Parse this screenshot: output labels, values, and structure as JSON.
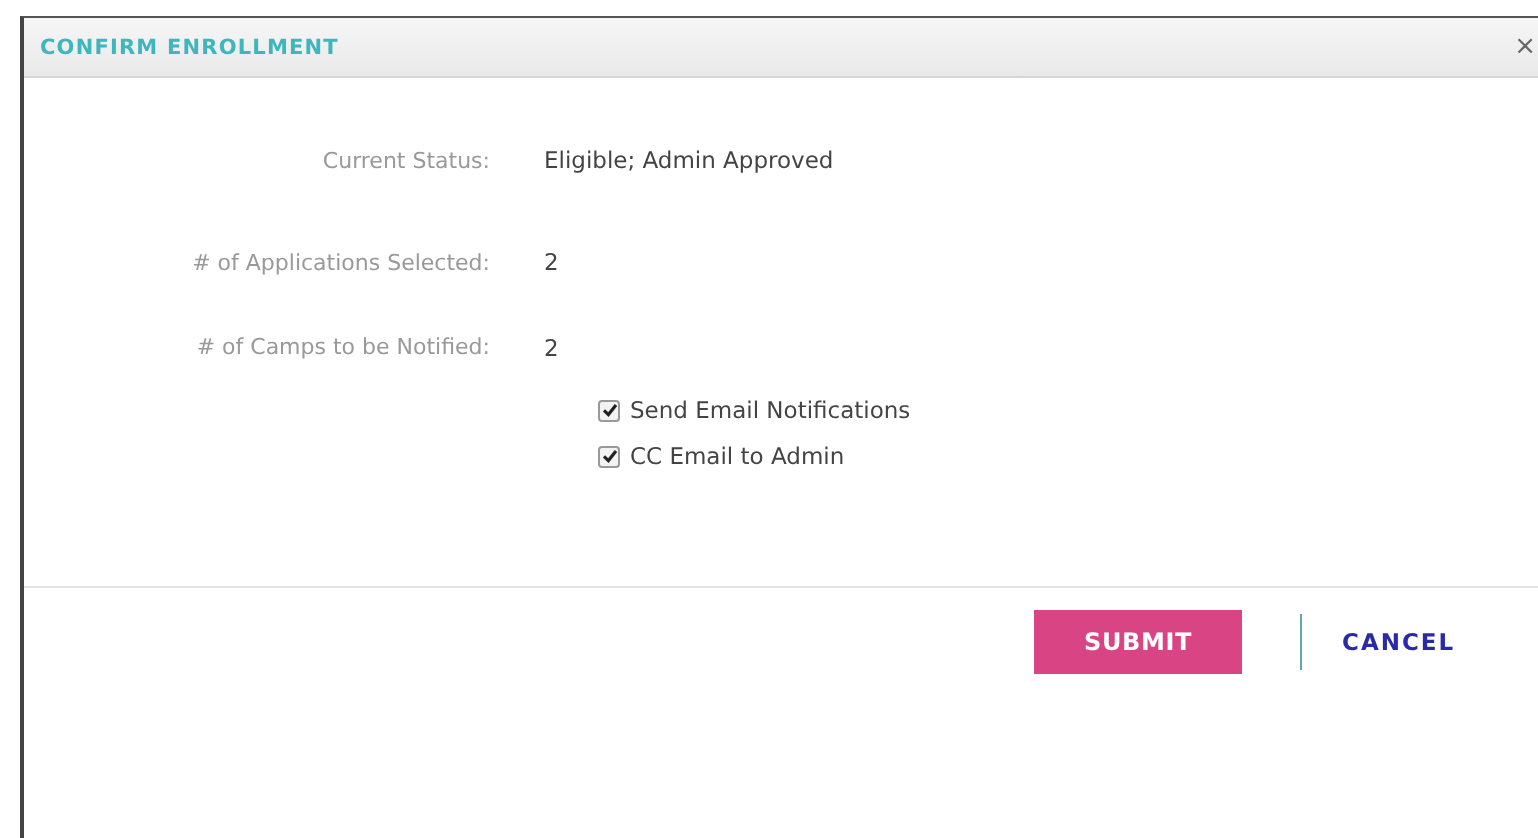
{
  "dialog": {
    "title": "CONFIRM ENROLLMENT",
    "close": "×"
  },
  "fields": [
    {
      "label": "Current Status:",
      "value": "Eligible; Admin Approved"
    },
    {
      "label": "# of Applications Selected:",
      "value": "2"
    },
    {
      "label": "# of Camps to be Notified:",
      "value": "2"
    }
  ],
  "options": [
    {
      "label": "Send Email Notifications",
      "checked": true
    },
    {
      "label": "CC Email to Admin",
      "checked": true
    }
  ],
  "buttons": {
    "submit": "SUBMIT",
    "cancel": "CANCEL"
  }
}
